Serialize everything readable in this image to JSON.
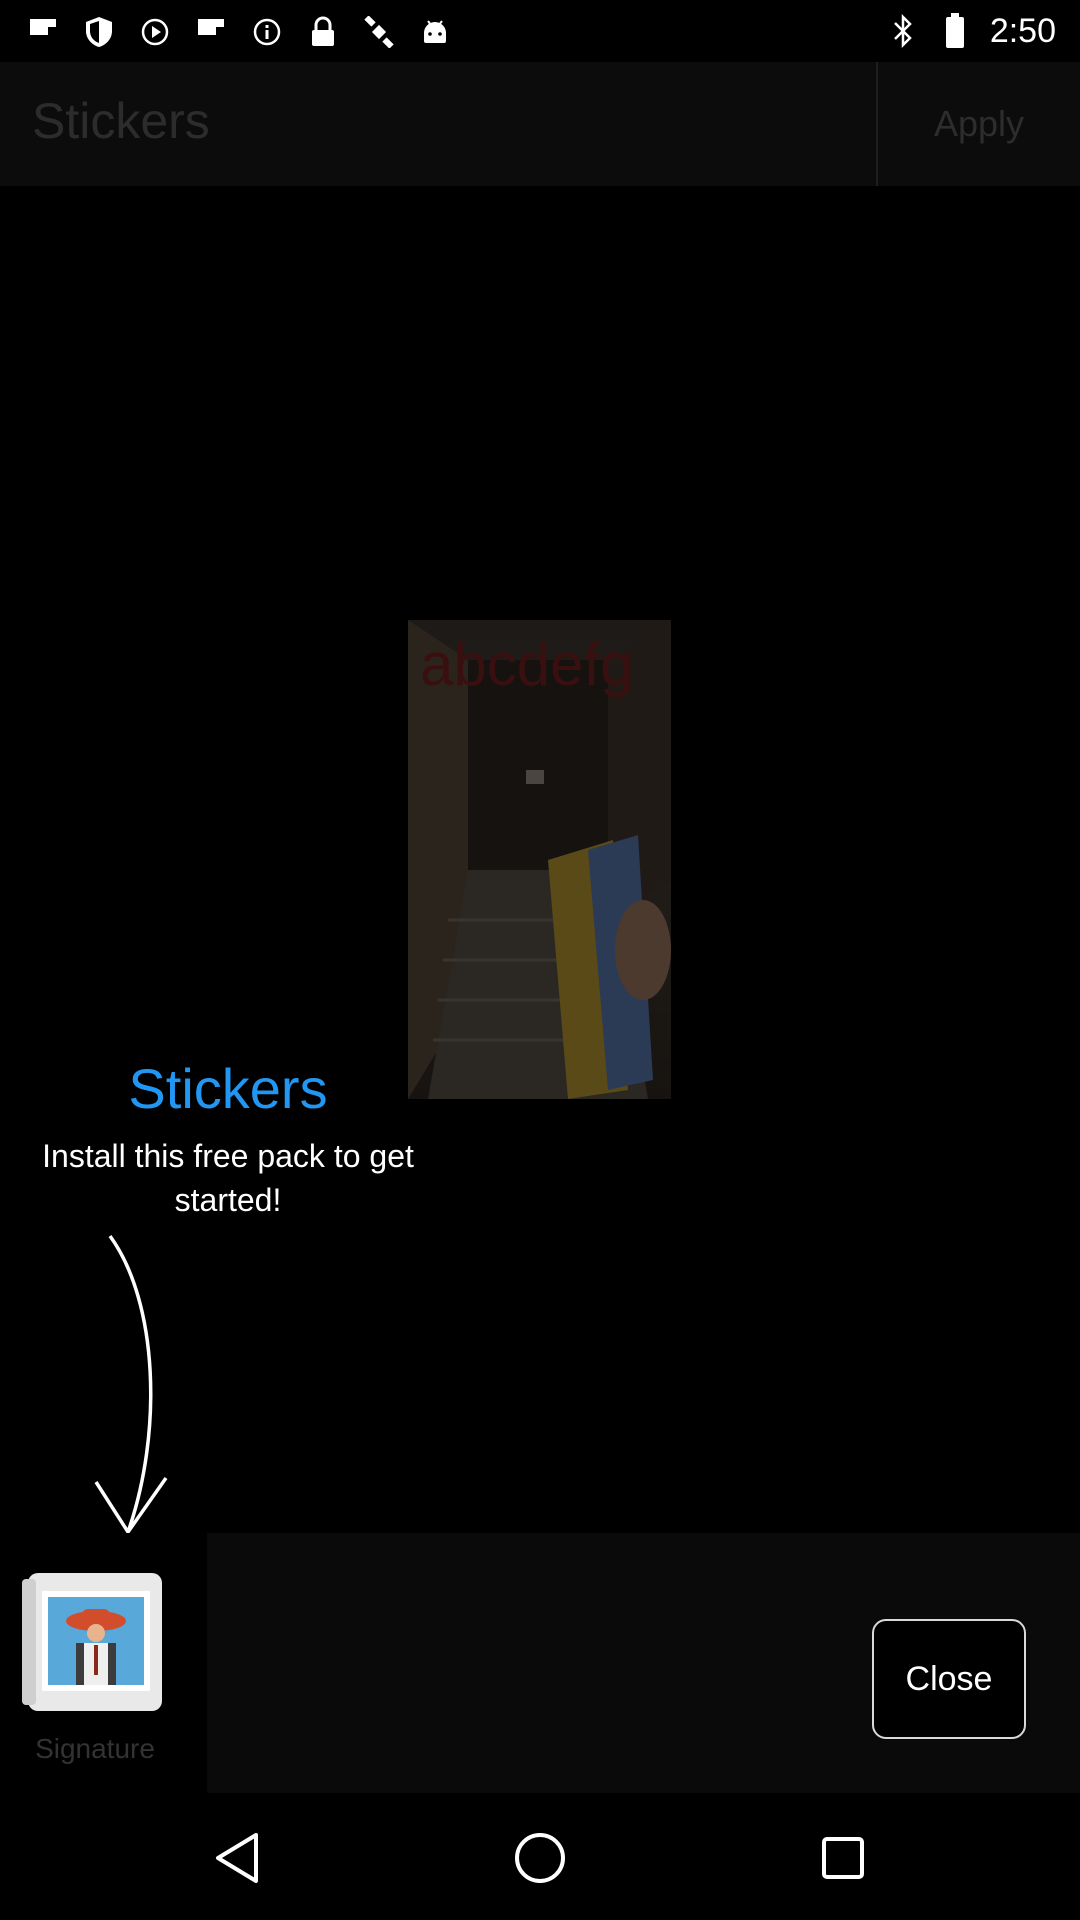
{
  "status_bar": {
    "time": "2:50",
    "icons": [
      "flipboard-icon",
      "shield-icon",
      "play-icon",
      "flipboard-icon",
      "info-icon",
      "lock-icon",
      "satellite-icon",
      "android-icon",
      "bluetooth-icon",
      "battery-icon"
    ]
  },
  "app_bar": {
    "title": "Stickers",
    "apply_label": "Apply"
  },
  "preview": {
    "overlay_text": "abcdefg"
  },
  "coach_mark": {
    "title": "Stickers",
    "body": "Install this free pack to get started!"
  },
  "tray": {
    "sticker_label": "Signature",
    "close_label": "Close"
  },
  "colors": {
    "accent": "#2196f3",
    "background": "#000000"
  }
}
